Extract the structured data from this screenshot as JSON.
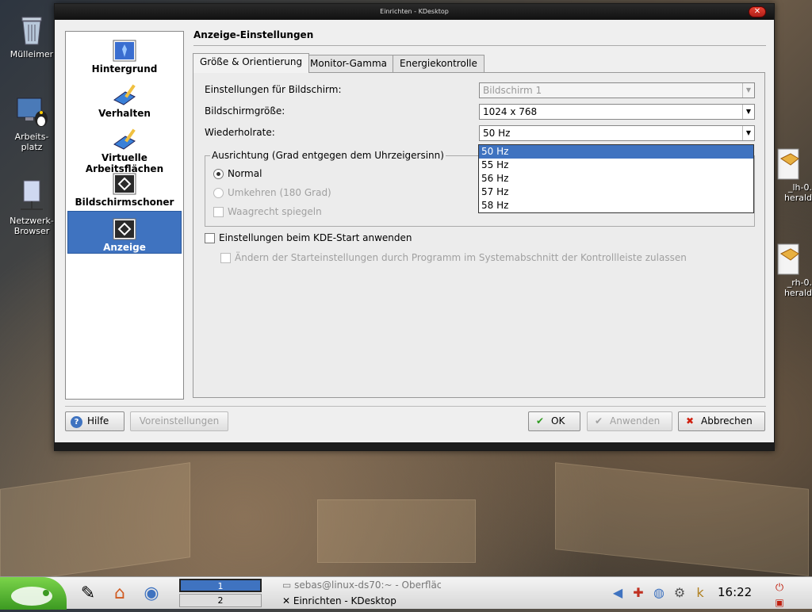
{
  "window": {
    "title": "Einrichten - KDesktop",
    "close_symbol": "✕"
  },
  "desktop_icons": [
    {
      "label": "Mülleimer",
      "icon": "trash-icon"
    },
    {
      "label": "Arbeits-\nplatz",
      "icon": "computer-icon"
    },
    {
      "label": "Netzwerk-\nBrowser",
      "icon": "network-icon"
    }
  ],
  "right_icons": [
    {
      "label": "_lh-0.\nherald",
      "icon": "package-icon"
    },
    {
      "label": "_rh-0.\nherald",
      "icon": "package-icon"
    }
  ],
  "categories": [
    {
      "label": "Hintergrund",
      "icon": "background-icon",
      "selected": false
    },
    {
      "label": "Verhalten",
      "icon": "behavior-icon",
      "selected": false
    },
    {
      "label": "Virtuelle Arbeitsflächen",
      "icon": "virtual-desktops-icon",
      "selected": false
    },
    {
      "label": "Bildschirmschoner",
      "icon": "screensaver-icon",
      "selected": false
    },
    {
      "label": "Anzeige",
      "icon": "display-icon",
      "selected": true
    }
  ],
  "panel_title": "Anzeige-Einstellungen",
  "tabs": [
    {
      "label": "Größe & Orientierung",
      "active": true
    },
    {
      "label": "Monitor-Gamma",
      "active": false
    },
    {
      "label": "Energiekontrolle",
      "active": false
    }
  ],
  "form": {
    "screen_label": "Einstellungen für Bildschirm:",
    "screen_value": "Bildschirm 1",
    "size_label": "Bildschirmgröße:",
    "size_value": "1024 x 768",
    "rate_label": "Wiederholrate:",
    "rate_value": "50 Hz",
    "orientation_title": "Ausrichtung (Grad entgegen dem Uhrzeigersinn)",
    "radio_normal": "Normal",
    "radio_reverse": "Umkehren (180 Grad)",
    "check_mirror": "Waagrecht spiegeln",
    "check_kde_start": "Einstellungen beim KDE-Start anwenden",
    "check_tray": "Ändern der Starteinstellungen durch Programm im Systemabschnitt der Kontrollleiste zulassen"
  },
  "rate_options": [
    "50 Hz",
    "55 Hz",
    "56 Hz",
    "57 Hz",
    "58 Hz"
  ],
  "rate_selected_index": 0,
  "buttons": {
    "help": "Hilfe",
    "defaults": "Voreinstellungen",
    "ok": "OK",
    "apply": "Anwenden",
    "cancel": "Abbrechen"
  },
  "taskbar": {
    "pager": [
      "1",
      "2"
    ],
    "active_desktop": "1",
    "tasks": [
      {
        "label": "sebas@linux-ds70:~ - Oberfläc",
        "active": false
      },
      {
        "label": "Einrichten - KDesktop",
        "active": true
      }
    ],
    "clock": "16:22"
  },
  "colors": {
    "selection": "#3f73c0",
    "window_bg": "#efefef",
    "titlebar": "#111111"
  }
}
